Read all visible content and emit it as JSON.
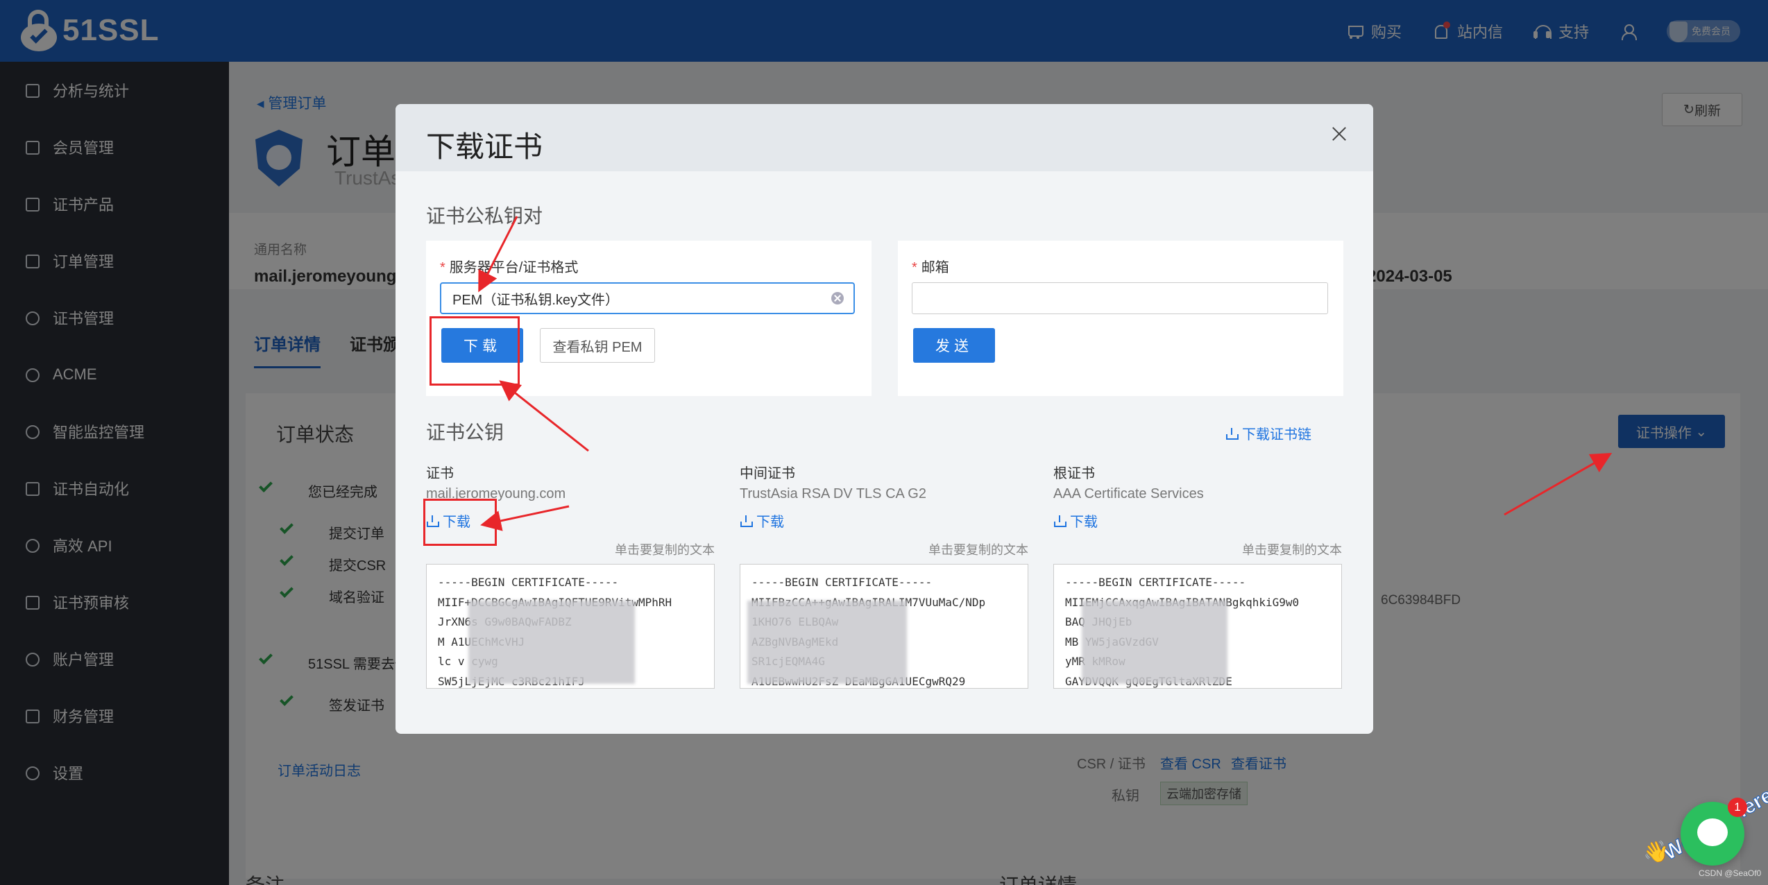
{
  "topbar": {
    "logo_text": "51SSL",
    "actions": [
      {
        "icon": "cart-icon",
        "label": "购买"
      },
      {
        "icon": "bell-icon",
        "label": "站内信"
      },
      {
        "icon": "headset-icon",
        "label": "支持"
      }
    ],
    "member_label": "免费会员"
  },
  "sidebar": {
    "items": [
      {
        "label": "分析与统计",
        "icon": "chart-icon"
      },
      {
        "label": "会员管理",
        "icon": "crown-icon"
      },
      {
        "label": "证书产品",
        "icon": "list-icon"
      },
      {
        "label": "订单管理",
        "icon": "document-icon"
      },
      {
        "label": "证书管理",
        "icon": "shield-check-icon"
      },
      {
        "label": "ACME",
        "icon": "nodes-icon"
      },
      {
        "label": "智能监控管理",
        "icon": "monitor-icon"
      },
      {
        "label": "证书自动化",
        "icon": "sitemap-icon"
      },
      {
        "label": "高效 API",
        "icon": "link-icon"
      },
      {
        "label": "证书预审核",
        "icon": "checklist-icon"
      },
      {
        "label": "账户管理",
        "icon": "user-icon"
      },
      {
        "label": "财务管理",
        "icon": "yen-icon"
      },
      {
        "label": "设置",
        "icon": "gear-icon"
      }
    ]
  },
  "page": {
    "breadcrumb": "管理订单",
    "title": "订单",
    "subtitle": "TrustAs",
    "refresh_label": "刷新",
    "common_name_label": "通用名称",
    "common_name_value": "mail.jeromeyoung.",
    "date_value": "2024-03-05",
    "tabs": [
      "订单详情",
      "证书颁"
    ],
    "order_status_title": "订单状态",
    "cert_ops_label": "证书操作",
    "status_items": [
      "您已经完成",
      "提交订单",
      "提交CSR",
      "域名验证",
      "51SSL 需要去做",
      "签发证书"
    ],
    "activity_log_link": "订单活动日志",
    "serial_partial": "6C63984BFD",
    "csr_label": "CSR / 证书",
    "view_csr": "查看 CSR",
    "view_cert": "查看证书",
    "private_key_label": "私钥",
    "cloud_storage_badge": "云端加密存储",
    "notes_title": "备注",
    "order_details_title": "订单详情"
  },
  "modal": {
    "title": "下载证书",
    "keypair_section": "证书公私钥对",
    "platform_label": "服务器平台/证书格式",
    "platform_value": "PEM（证书私钥.key文件）",
    "download_btn": "下载",
    "view_pem_btn": "查看私钥 PEM",
    "email_label": "邮箱",
    "send_btn": "发送",
    "pubkey_section": "证书公钥",
    "download_chain": "下载证书链",
    "copy_hint": "单击要复制的文本",
    "certs": [
      {
        "name": "证书",
        "subject": "mail.jeromeyoung.com",
        "download": "下载",
        "lines": [
          "-----BEGIN CERTIFICATE-----",
          "MIIF+DCCBGCgAwIBAgIQFTUE9RVitwMPhRH",
          "JrXN6s          G9w0BAQwFADBZ",
          "M                    A1UEChMcVHJ",
          "lc                 v     cywg",
          "SW5jLjEjMC          c3RBc21hIFJ"
        ]
      },
      {
        "name": "中间证书",
        "subject": "TrustAsia RSA DV TLS CA G2",
        "download": "下载",
        "lines": [
          "-----BEGIN CERTIFICATE-----",
          "MIIFBzCCA++gAwIBAgIRALIM7VUuMaC/NDp",
          "1KHO76                   ELBQAw",
          "                      AZBgNVBAgMEkd",
          "                    SR1cjEQMA4G",
          "A1UEBwwHU2FsZ     DEaMBgGA1UECgwRQ29"
        ]
      },
      {
        "name": "根证书",
        "subject": "AAA Certificate Services",
        "download": "下载",
        "lines": [
          "-----BEGIN CERTIFICATE-----",
          "MIIEMjCCAxqgAwIBAgIBATANBgkqhkiG9w0",
          "BAQ                      JHQjEb",
          "MB                      YW5jaGVzdGV",
          "yMR                      kMRow",
          "GAYDVQQK                 gQ0EgTGltaXRlZDE"
        ]
      }
    ]
  },
  "chat": {
    "badge_count": "1",
    "tagline": "We Are Here!",
    "watermark": "CSDN @SeaOf0"
  },
  "colors": {
    "brand": "#1f63c3",
    "sidebar": "#2a2f36",
    "primary_button": "#2679de",
    "annotation_red": "#e8262a",
    "success_green": "#2fa84f"
  }
}
